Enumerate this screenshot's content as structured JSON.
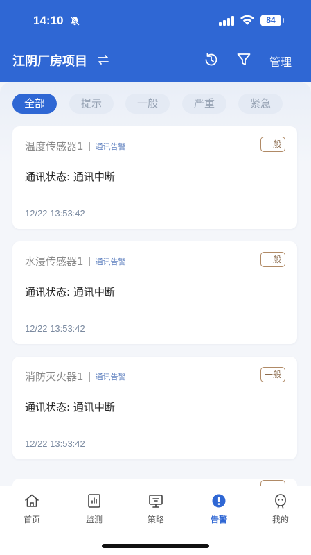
{
  "status_bar": {
    "time": "14:10",
    "battery": "84"
  },
  "header": {
    "title": "江阴厂房项目",
    "manage_label": "管理"
  },
  "filters": [
    {
      "label": "全部",
      "active": true
    },
    {
      "label": "提示",
      "active": false
    },
    {
      "label": "一般",
      "active": false
    },
    {
      "label": "严重",
      "active": false
    },
    {
      "label": "紧急",
      "active": false
    }
  ],
  "alarms": [
    {
      "device": "温度传感器1",
      "type": "通讯告警",
      "level": "一般",
      "status": "通讯状态: 通讯中断",
      "time": "12/22 13:53:42"
    },
    {
      "device": "水浸传感器1",
      "type": "通讯告警",
      "level": "一般",
      "status": "通讯状态: 通讯中断",
      "time": "12/22 13:53:42"
    },
    {
      "device": "消防灭火器1",
      "type": "通讯告警",
      "level": "一般",
      "status": "通讯状态: 通讯中断",
      "time": "12/22 13:53:42"
    }
  ],
  "tabs": [
    {
      "label": "首页",
      "icon": "home-icon"
    },
    {
      "label": "监测",
      "icon": "monitor-icon"
    },
    {
      "label": "策略",
      "icon": "strategy-icon"
    },
    {
      "label": "告警",
      "icon": "alarm-icon",
      "active": true
    },
    {
      "label": "我的",
      "icon": "profile-icon"
    }
  ],
  "colors": {
    "primary": "#2f67d4",
    "badge_border": "#b08a66",
    "alarm_type": "#5d7fbf"
  }
}
